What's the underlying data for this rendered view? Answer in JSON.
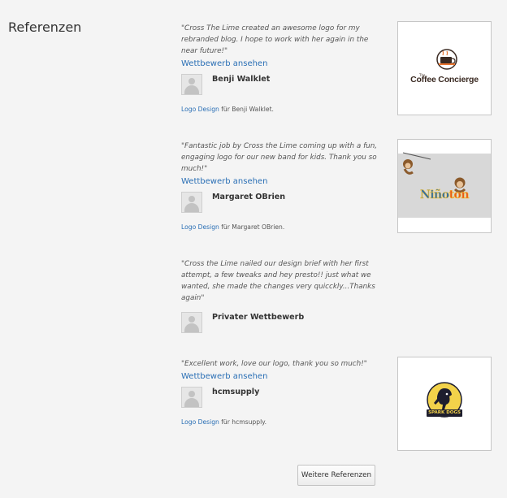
{
  "section": {
    "title": "Referenzen"
  },
  "references": [
    {
      "quote": "\"Cross The Lime created an awesome logo for my rebranded blog. I hope to work with her again in the near future!\"",
      "link": "Wettbewerb ansehen",
      "user": "Benji Walklet",
      "credit_category": "Logo Design",
      "credit_suffix": " für Benji Walklet.",
      "logo_text": "Coffee Concierge",
      "logo_small": "The"
    },
    {
      "quote": "\"Fantastic job by Cross the Lime coming up with a fun, engaging logo for our new band for kids. Thank you so much!\"",
      "link": "Wettbewerb ansehen",
      "user": "Margaret OBrien",
      "credit_category": "Logo Design",
      "credit_suffix": " für Margaret OBrien.",
      "logo_text_1": "Niño",
      "logo_text_2": "ton"
    },
    {
      "quote": "\"Cross the Lime nailed our design brief with her first attempt, a few tweaks and hey presto!! just what we wanted, she made the changes very quicckly...Thanks again\"",
      "user": "Privater Wettbewerb"
    },
    {
      "quote": "\"Excellent work, love our logo, thank you so much!\"",
      "link": "Wettbewerb ansehen",
      "user": "hcmsupply",
      "credit_category": "Logo Design",
      "credit_suffix": " für hcmsupply.",
      "logo_text": "SPARK DOGS"
    }
  ],
  "more_button": "Weitere Referenzen",
  "colors": {
    "link": "#2a6fb5",
    "background": "#f4f4f4"
  }
}
